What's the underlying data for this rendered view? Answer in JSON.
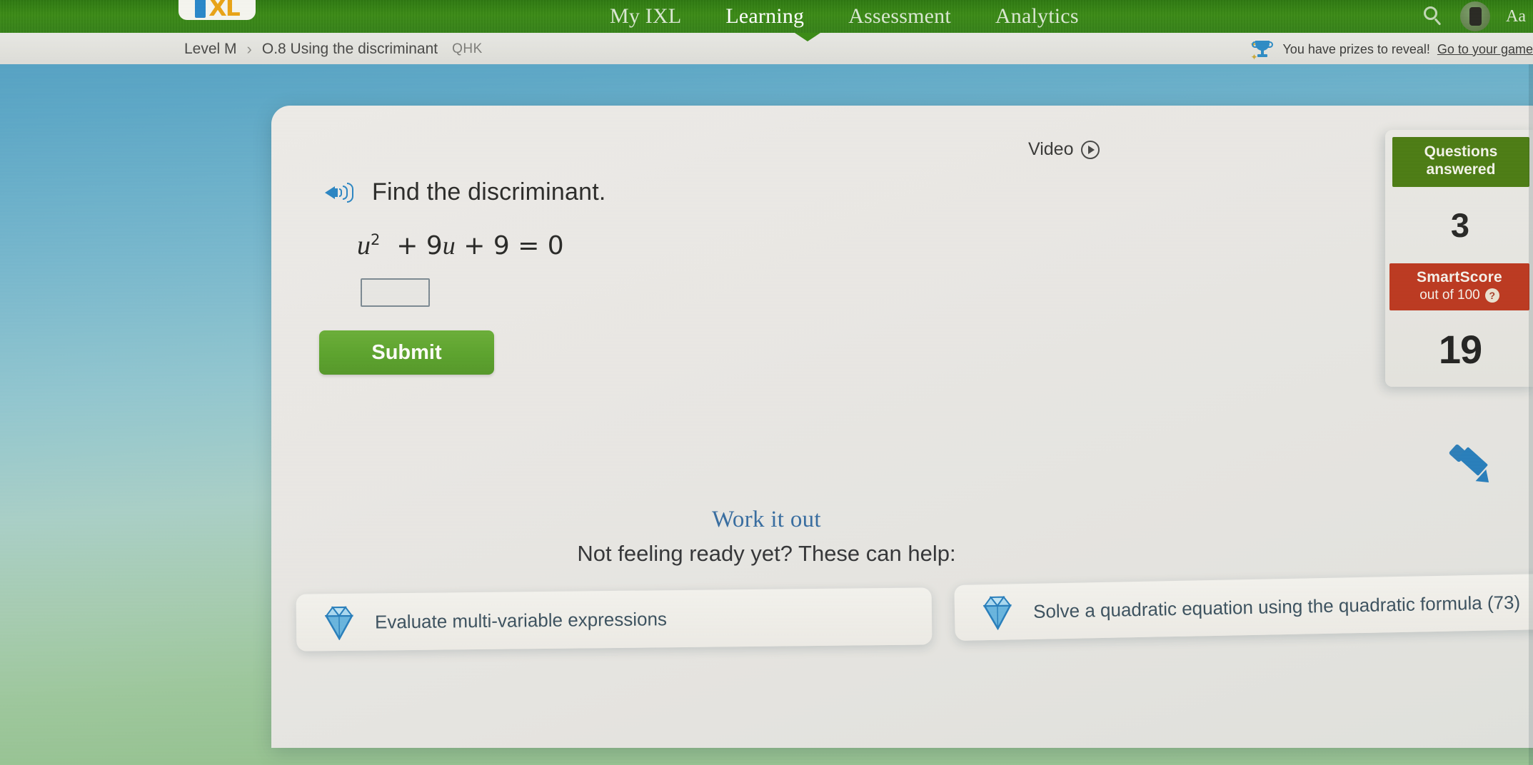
{
  "app": {
    "name": "IXL",
    "logo_i": "I",
    "logo_xl": "XL"
  },
  "topnav": {
    "items": [
      {
        "label": "My IXL",
        "active": false
      },
      {
        "label": "Learning",
        "active": true
      },
      {
        "label": "Assessment",
        "active": false
      },
      {
        "label": "Analytics",
        "active": false
      }
    ],
    "search_icon": "search-icon",
    "avatar_icon": "avatar",
    "username": "Aa"
  },
  "breadcrumb": {
    "level": "Level M",
    "separator": "›",
    "skill": "O.8 Using the discriminant",
    "code": "QHK"
  },
  "prizes": {
    "text": "You have prizes to reveal!",
    "link": "Go to your game",
    "icon": "trophy-icon"
  },
  "question": {
    "video_label": "Video",
    "audio_icon": "speaker-icon",
    "prompt": "Find the discriminant.",
    "equation": {
      "variable": "u",
      "exponent": "2",
      "rest": "+ 9u + 9 = 0",
      "full": "u2 + 9u + 9 = 0"
    },
    "answer_value": "",
    "answer_placeholder": "",
    "submit_label": "Submit",
    "scratchpad_icon": "pencil-icon"
  },
  "score": {
    "questions_answered_label_line1": "Questions",
    "questions_answered_label_line2": "answered",
    "questions_answered_value": "3",
    "smartscore_label": "SmartScore",
    "smartscore_sub": "out of 100",
    "smartscore_help_icon": "?",
    "smartscore_value": "19",
    "questions_badge_color": "#4e7d16",
    "smartscore_badge_color": "#bc3b22"
  },
  "work_it_out": {
    "title": "Work it out",
    "subtitle": "Not feeling ready yet? These can help:",
    "cards": [
      {
        "label": "Evaluate multi-variable expressions",
        "icon": "gem-icon"
      },
      {
        "label": "Solve a quadratic equation using the quadratic formula (73)",
        "icon": "gem-icon"
      }
    ]
  },
  "theme": {
    "nav_green": "#3c8b17",
    "submit_green": "#5da32e",
    "accent_blue": "#2d86c2",
    "link_blue": "#3a6ea0"
  }
}
